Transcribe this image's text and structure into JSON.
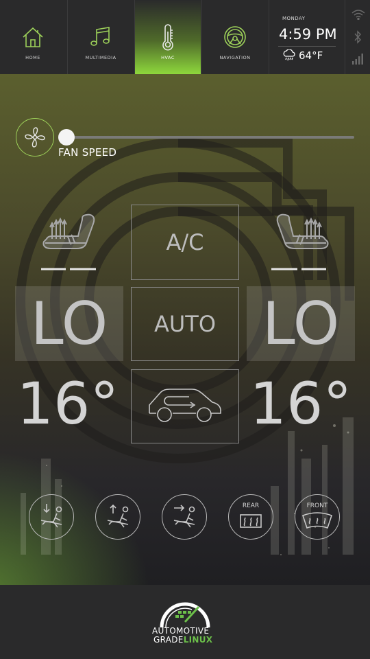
{
  "nav": {
    "items": [
      {
        "label": "HOME",
        "icon": "home-icon"
      },
      {
        "label": "MULTIMEDIA",
        "icon": "music-note-icon"
      },
      {
        "label": "HVAC",
        "icon": "thermometer-icon",
        "active": true
      },
      {
        "label": "NAVIGATION",
        "icon": "steering-wheel-icon"
      }
    ]
  },
  "status": {
    "day": "MONDAY",
    "time": "4:59 PM",
    "weather_icon": "rain-cloud-icon",
    "temperature": "64°F",
    "icons": [
      "wifi-icon",
      "bluetooth-icon",
      "signal-bars-icon"
    ]
  },
  "hvac": {
    "fan": {
      "label": "FAN SPEED",
      "level": 0
    },
    "ac_label": "A/C",
    "auto_label": "AUTO",
    "left": {
      "fan_level": "LO",
      "temperature": "16°"
    },
    "right": {
      "fan_level": "LO",
      "temperature": "16°"
    },
    "modes": [
      {
        "icon": "airflow-down-icon"
      },
      {
        "icon": "airflow-up-icon"
      },
      {
        "icon": "airflow-front-icon"
      },
      {
        "label": "REAR",
        "icon": "rear-defrost-icon"
      },
      {
        "label": "FRONT",
        "icon": "front-defrost-icon"
      }
    ]
  },
  "brand": {
    "line1": "AUTOMOTIVE",
    "line2a": "GRADE",
    "line2b": "LINUX",
    "accent": "#6cc04a"
  },
  "colors": {
    "accent": "#8ed83c",
    "bar_bg": "#2a2a2b"
  }
}
